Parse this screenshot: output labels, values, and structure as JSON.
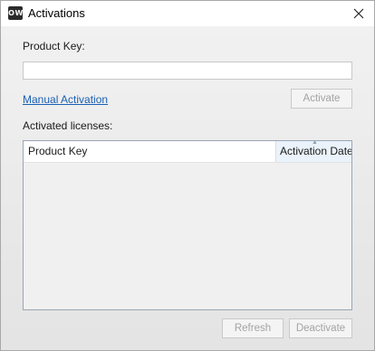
{
  "window": {
    "title": "Activations",
    "icon": "app-logo-icon",
    "close_icon": "close-icon"
  },
  "form": {
    "product_key_label": "Product Key:",
    "product_key_value": "",
    "product_key_placeholder": "",
    "manual_activation_link": "Manual Activation",
    "activate_button": "Activate",
    "activated_licenses_label": "Activated licenses:"
  },
  "licenses_table": {
    "columns": [
      "Product Key",
      "Activation Date"
    ],
    "sort_column": "Activation Date",
    "sort_direction": "ascending",
    "rows": []
  },
  "footer": {
    "refresh_button": "Refresh",
    "deactivate_button": "Deactivate"
  },
  "colors": {
    "link": "#1a5fb4",
    "disabled_text": "#a3a3a3",
    "list_border": "#9aa6b4",
    "sorted_header_bg": "#eaf3fb"
  }
}
